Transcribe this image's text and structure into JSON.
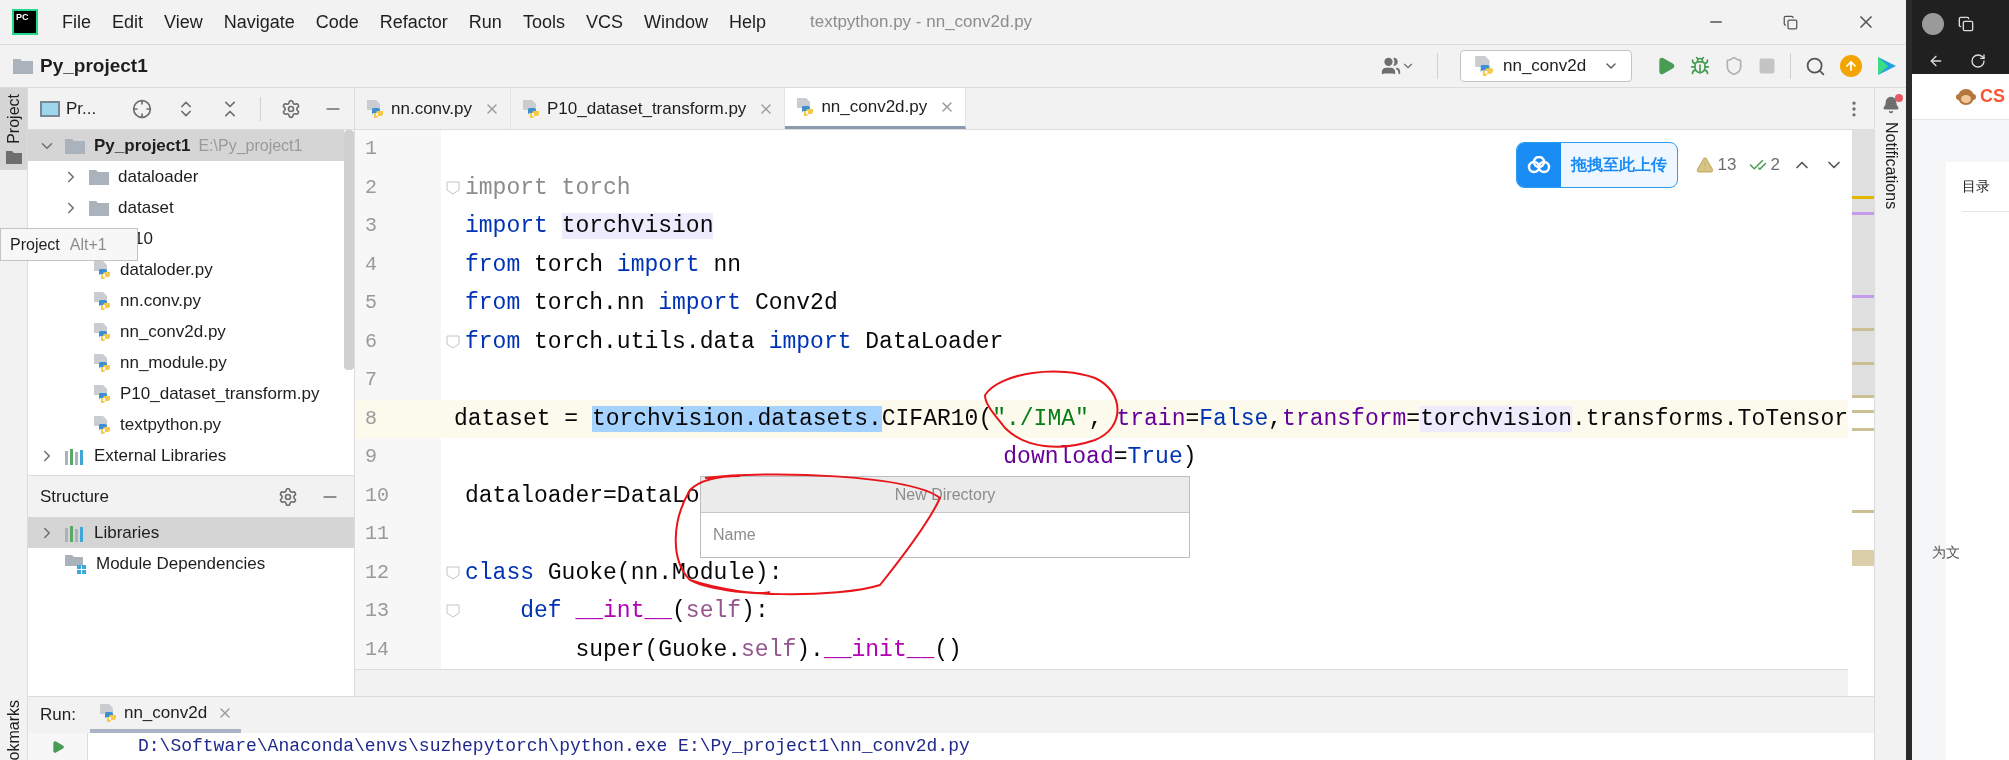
{
  "app": {
    "logo": "PC",
    "menu": [
      "File",
      "Edit",
      "View",
      "Navigate",
      "Code",
      "Refactor",
      "Run",
      "Tools",
      "VCS",
      "Window",
      "Help"
    ],
    "title": "textpython.py - nn_conv2d.py"
  },
  "project_name": "Py_project1",
  "toolbar": {
    "run_config": "nn_conv2d",
    "stop_disabled": true
  },
  "left_stripe": [
    {
      "label": "Project",
      "selected": true
    },
    {
      "label": "okmarks",
      "selected": false
    }
  ],
  "project_panel": {
    "title": "Pr...",
    "tree": [
      {
        "label": "Py_project1",
        "path": "E:\\Py_project1",
        "kind": "folder",
        "expanded": true,
        "selected": true,
        "children": [
          {
            "label": "dataloader",
            "kind": "folder",
            "expanded": false,
            "selected": false
          },
          {
            "label": "dataset",
            "kind": "folder",
            "expanded": false,
            "selected": false
          },
          {
            "label": "10",
            "kind": "covered",
            "selected": false
          },
          {
            "label": "dataloder.py",
            "kind": "file",
            "selected": false
          },
          {
            "label": "nn.conv.py",
            "kind": "file",
            "selected": false
          },
          {
            "label": "nn_conv2d.py",
            "kind": "file",
            "selected": false
          },
          {
            "label": "nn_module.py",
            "kind": "file",
            "selected": false
          },
          {
            "label": "P10_dataset_transform.py",
            "kind": "file",
            "selected": false
          },
          {
            "label": "textpython.py",
            "kind": "file",
            "selected": false
          }
        ]
      },
      {
        "label": "External Libraries",
        "kind": "library",
        "expanded": false,
        "selected": false
      }
    ]
  },
  "tooltip": {
    "label": "Project",
    "shortcut": "Alt+1"
  },
  "structure": {
    "title": "Structure",
    "items": [
      {
        "label": "Libraries",
        "kind": "library",
        "selected": true
      },
      {
        "label": "Module Dependencies",
        "kind": "modules",
        "selected": false
      }
    ]
  },
  "tabs": [
    {
      "label": "nn.conv.py",
      "selected": false
    },
    {
      "label": "P10_dataset_transform.py",
      "selected": false
    },
    {
      "label": "nn_conv2d.py",
      "selected": true
    }
  ],
  "upload_button": "拖拽至此上传",
  "inspections": {
    "warnings": "13",
    "passed": "2"
  },
  "editor": {
    "lines": [
      {
        "number": "1",
        "current": false,
        "fold": false
      },
      {
        "number": "2",
        "current": false,
        "fold": true,
        "tokens": [
          {
            "text": "import torch",
            "kind": "unused"
          }
        ]
      },
      {
        "number": "3",
        "current": false,
        "fold": false,
        "tokens": [
          {
            "text": "import ",
            "kind": "kw"
          },
          {
            "text": "torchvision",
            "kind": "usage"
          }
        ]
      },
      {
        "number": "4",
        "current": false,
        "fold": false,
        "tokens": [
          {
            "text": "from",
            "kind": "kw"
          },
          {
            "text": " torch ",
            "kind": "plain"
          },
          {
            "text": "import",
            "kind": "kw"
          },
          {
            "text": " nn",
            "kind": "plain"
          }
        ]
      },
      {
        "number": "5",
        "current": false,
        "fold": false,
        "tokens": [
          {
            "text": "from",
            "kind": "kw"
          },
          {
            "text": " torch.nn ",
            "kind": "plain"
          },
          {
            "text": "import",
            "kind": "kw"
          },
          {
            "text": " Conv2d",
            "kind": "plain"
          }
        ]
      },
      {
        "number": "6",
        "current": false,
        "fold": true,
        "tokens": [
          {
            "text": "from",
            "kind": "kw"
          },
          {
            "text": " torch.utils.data ",
            "kind": "plain"
          },
          {
            "text": "import",
            "kind": "kw"
          },
          {
            "text": " DataLoader",
            "kind": "plain"
          }
        ]
      },
      {
        "number": "7",
        "current": false,
        "fold": false
      },
      {
        "number": "8",
        "current": true,
        "fold": false,
        "tokens": [
          {
            "text": "dataset = ",
            "kind": "plain"
          },
          {
            "text": "torchvision.datasets.",
            "kind": "sel"
          },
          {
            "text": "CIFAR10(",
            "kind": "plain"
          },
          {
            "text": "\"./IMA\"",
            "kind": "str"
          },
          {
            "text": ", ",
            "kind": "plain"
          },
          {
            "text": "train",
            "kind": "param"
          },
          {
            "text": "=",
            "kind": "plain"
          },
          {
            "text": "False",
            "kind": "kw"
          },
          {
            "text": ",",
            "kind": "plain"
          },
          {
            "text": "transform",
            "kind": "param"
          },
          {
            "text": "=",
            "kind": "plain"
          },
          {
            "text": "torchvision",
            "kind": "usage"
          },
          {
            "text": ".transforms.ToTensor",
            "kind": "plain"
          }
        ]
      },
      {
        "number": "9",
        "current": false,
        "fold": false,
        "kind": "continuation",
        "tokens": [
          {
            "text": "download",
            "kind": "param"
          },
          {
            "text": "=",
            "kind": "plain"
          },
          {
            "text": "True",
            "kind": "kw"
          },
          {
            "text": ")",
            "kind": "plain"
          }
        ]
      },
      {
        "number": "10",
        "current": false,
        "fold": false,
        "tokens": [
          {
            "text": "dataloader=DataLo",
            "kind": "plain"
          }
        ]
      },
      {
        "number": "11",
        "current": false,
        "fold": false
      },
      {
        "number": "12",
        "current": false,
        "fold": true,
        "tokens": [
          {
            "text": "class",
            "kind": "kw"
          },
          {
            "text": " Guoke(nn.Module):",
            "kind": "plain"
          }
        ]
      },
      {
        "number": "13",
        "current": false,
        "fold": true,
        "kind": "block",
        "tokens": [
          {
            "text": "def ",
            "kind": "kw"
          },
          {
            "text": "__int__",
            "kind": "fn"
          },
          {
            "text": "(",
            "kind": "plain"
          },
          {
            "text": "self",
            "kind": "self"
          },
          {
            "text": "):",
            "kind": "plain"
          }
        ]
      },
      {
        "number": "14",
        "current": false,
        "fold": false,
        "kind": "nested",
        "tokens": [
          {
            "text": "super(Guoke.",
            "kind": "plain"
          },
          {
            "text": "self",
            "kind": "self"
          },
          {
            "text": ").",
            "kind": "plain"
          },
          {
            "text": "__init__",
            "kind": "fn"
          },
          {
            "text": "()",
            "kind": "plain"
          }
        ]
      }
    ]
  },
  "dialog": {
    "title": "New Directory",
    "placeholder": "Name"
  },
  "right_stripe": {
    "label": "Notifications",
    "unread": true
  },
  "run": {
    "label": "Run:",
    "tabs": [
      {
        "label": "nn_conv2d",
        "selected": true
      }
    ],
    "output": "D:\\Software\\Anaconda\\envs\\suzhepytorch\\python.exe E:\\Py_project1\\nn_conv2d.py"
  },
  "browser": {
    "tab": "CS",
    "toc": "目录",
    "text": "为文"
  }
}
